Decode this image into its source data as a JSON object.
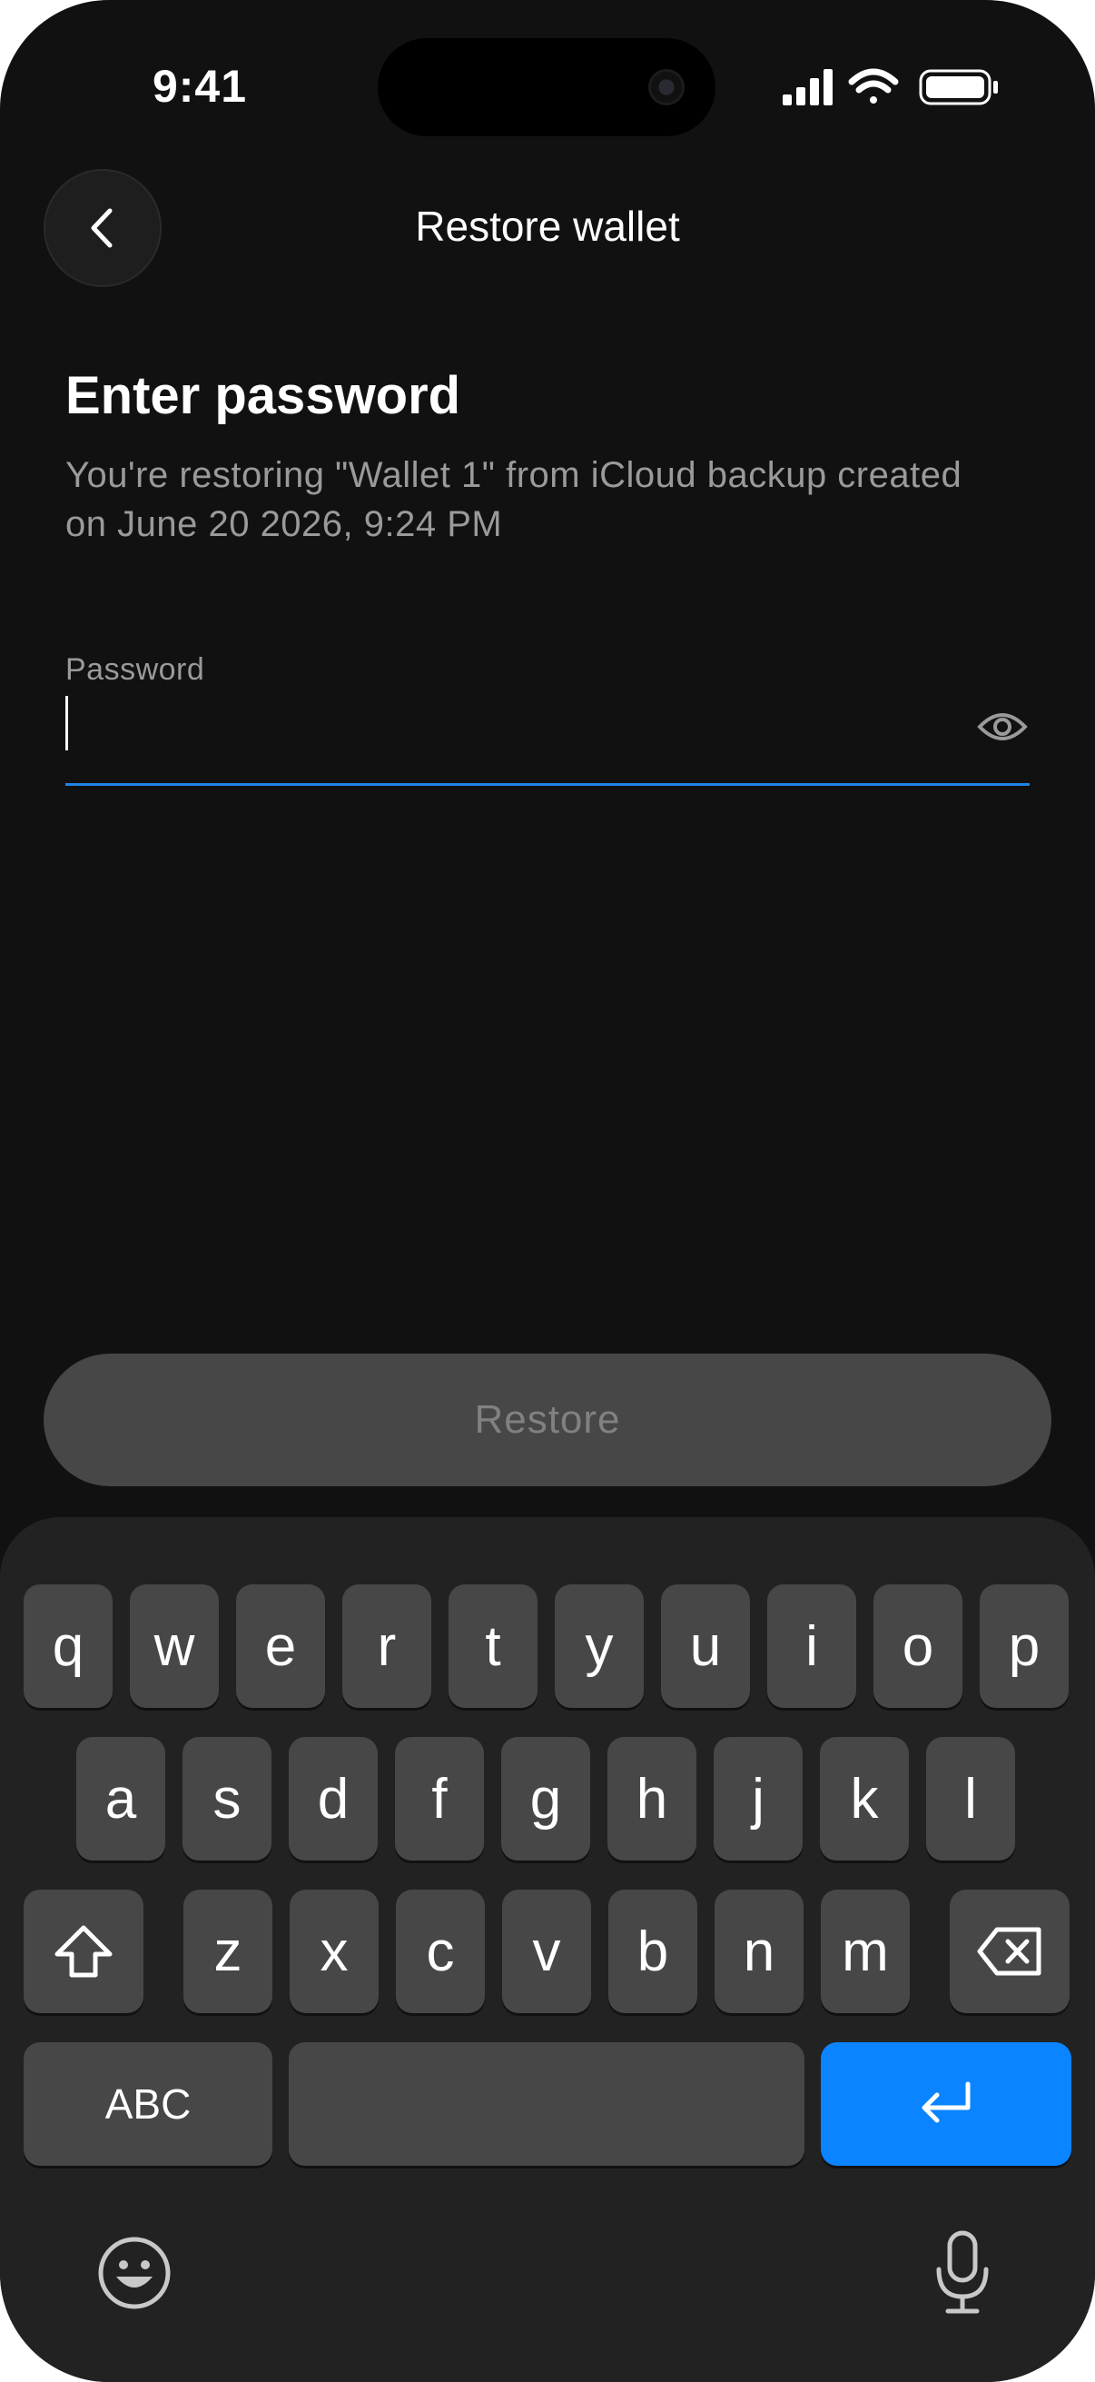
{
  "status_bar": {
    "time": "9:41"
  },
  "header": {
    "title": "Restore wallet",
    "back_icon": "chevron-left-icon"
  },
  "main": {
    "heading": "Enter password",
    "subtitle": "You're restoring \"Wallet 1\" from iCloud backup created on June 20 2026, 9:24 PM",
    "password_field": {
      "label": "Password",
      "value": "",
      "toggle_icon": "eye-icon"
    },
    "restore_button": "Restore"
  },
  "keyboard": {
    "row1": [
      "q",
      "w",
      "e",
      "r",
      "t",
      "y",
      "u",
      "i",
      "o",
      "p"
    ],
    "row2": [
      "a",
      "s",
      "d",
      "f",
      "g",
      "h",
      "j",
      "k",
      "l"
    ],
    "row3": [
      "z",
      "x",
      "c",
      "v",
      "b",
      "n",
      "m"
    ],
    "abc_label": "ABC",
    "icons": [
      "shift-icon",
      "delete-icon",
      "return-icon",
      "emoji-icon",
      "microphone-icon"
    ]
  },
  "colors": {
    "background": "#111111",
    "accent": "#0a84ff",
    "input_underline": "#1e84e6",
    "key": "#474747",
    "keyboard": "#222222",
    "disabled_button": "#474747",
    "disabled_text": "#818181",
    "muted_text": "#9a9a9a"
  }
}
